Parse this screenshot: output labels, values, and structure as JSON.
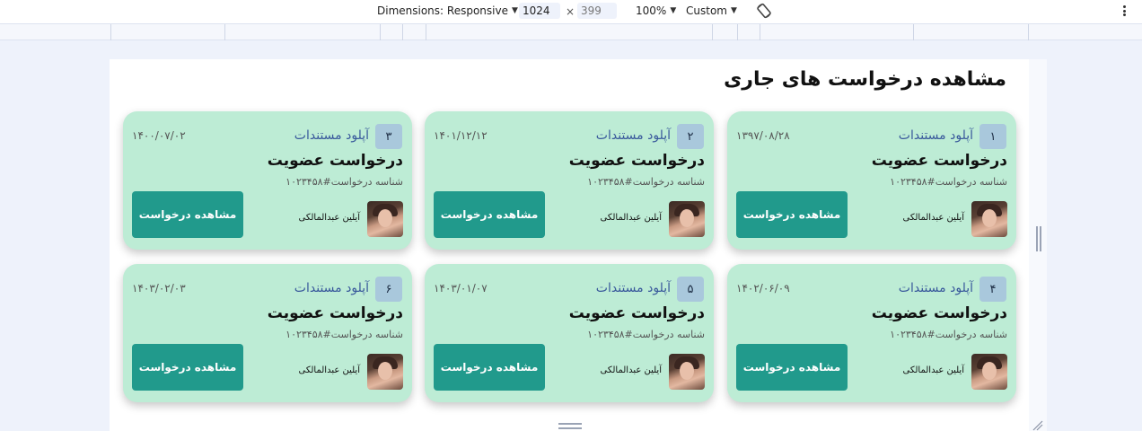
{
  "devtools": {
    "dimensions_label": "Dimensions: Responsive",
    "width": "1024",
    "height": "399",
    "zoom": "100%",
    "throttle": "Custom",
    "icons": {
      "rotate": "rotate-icon",
      "more": "more-vert-icon"
    }
  },
  "page": {
    "title": "مشاهده درخواست های جاری"
  },
  "cards": [
    {
      "num": "۱",
      "status": "آپلود مستندات",
      "date": "۱۳۹۷/۰۸/۲۸",
      "title": "درخواست عضویت",
      "req_id": "شناسه درخواست#۱۰۲۳۴۵۸",
      "person": "آیلین عبدالمالکی",
      "button": "مشاهده درخواست"
    },
    {
      "num": "۲",
      "status": "آپلود مستندات",
      "date": "۱۴۰۱/۱۲/۱۲",
      "title": "درخواست عضویت",
      "req_id": "شناسه درخواست#۱۰۲۳۴۵۸",
      "person": "آیلین عبدالمالکی",
      "button": "مشاهده درخواست"
    },
    {
      "num": "۳",
      "status": "آپلود مستندات",
      "date": "۱۴۰۰/۰۷/۰۲",
      "title": "درخواست عضویت",
      "req_id": "شناسه درخواست#۱۰۲۳۴۵۸",
      "person": "آیلین عبدالمالکی",
      "button": "مشاهده درخواست"
    },
    {
      "num": "۴",
      "status": "آپلود مستندات",
      "date": "۱۴۰۲/۰۶/۰۹",
      "title": "درخواست عضویت",
      "req_id": "شناسه درخواست#۱۰۲۳۴۵۸",
      "person": "آیلین عبدالمالکی",
      "button": "مشاهده درخواست"
    },
    {
      "num": "۵",
      "status": "آپلود مستندات",
      "date": "۱۴۰۳/۰۱/۰۷",
      "title": "درخواست عضویت",
      "req_id": "شناسه درخواست#۱۰۲۳۴۵۸",
      "person": "آیلین عبدالمالکی",
      "button": "مشاهده درخواست"
    },
    {
      "num": "۶",
      "status": "آپلود مستندات",
      "date": "۱۴۰۳/۰۲/۰۳",
      "title": "درخواست عضویت",
      "req_id": "شناسه درخواست#۱۰۲۳۴۵۸",
      "person": "آیلین عبدالمالکی",
      "button": "مشاهده درخواست"
    }
  ],
  "colors": {
    "card_bg": "#bdecd5",
    "button_bg": "#219a8c",
    "badge_bg": "#a9c8dc",
    "status_text": "#3a5a9c"
  }
}
